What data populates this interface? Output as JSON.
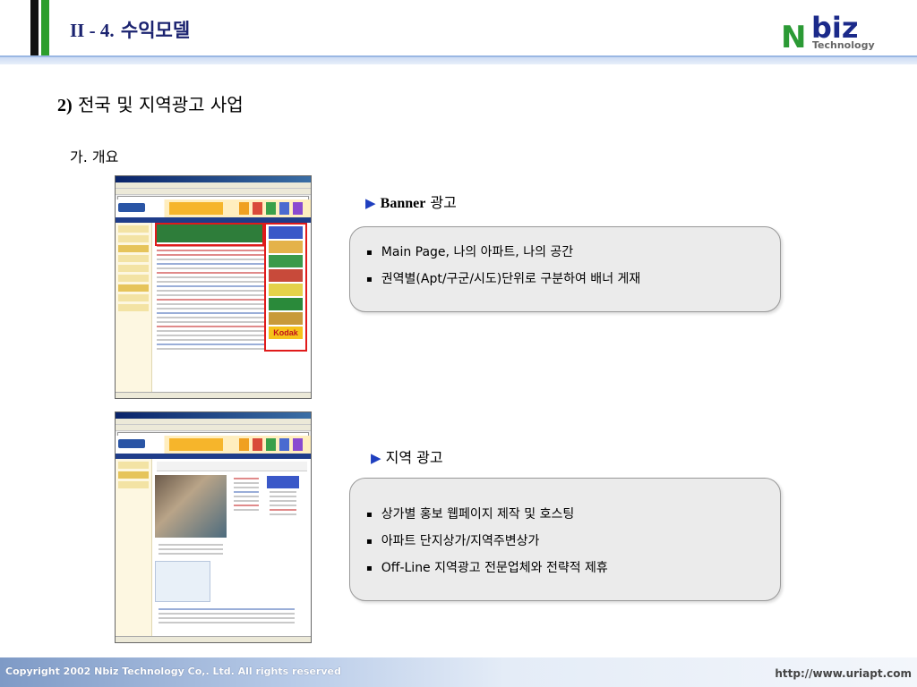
{
  "header": {
    "title_prefix": "II - 4.",
    "title_text": "수익모델",
    "logo": {
      "letter": "N",
      "word": "biz",
      "subtitle": "Technology"
    }
  },
  "section": {
    "number": "2)",
    "title": "전국 및 지역광고 사업",
    "subtitle": "가. 개요"
  },
  "callouts": [
    {
      "marker": "▶",
      "label_lat": "Banner",
      "label_kor": "광고",
      "items": [
        "Main Page, 나의 아파트, 나의 공간",
        "권역별(Apt/구군/시도)단위로 구분하여 배너 게재"
      ]
    },
    {
      "marker": "▶",
      "label_lat": "",
      "label_kor": "지역 광고",
      "items": [
        "상가별 홍보 웹페이지 제작 및 호스팅",
        "아파트 단지상가/지역주변상가",
        "Off-Line 지역광고 전문업체와 전략적 제휴"
      ]
    }
  ],
  "screenshots": {
    "banner_ad_text": "Kodak"
  },
  "colors": {
    "title": "#1b2370",
    "accent_green": "#2c9e2c",
    "highlight_red": "#e01b1b",
    "logo_blue": "#1b2a8a"
  },
  "footer": {
    "copyright": "Copyright 2002 Nbiz Technology Co,. Ltd. All rights reserved",
    "url": "http://www.uriapt.com"
  }
}
